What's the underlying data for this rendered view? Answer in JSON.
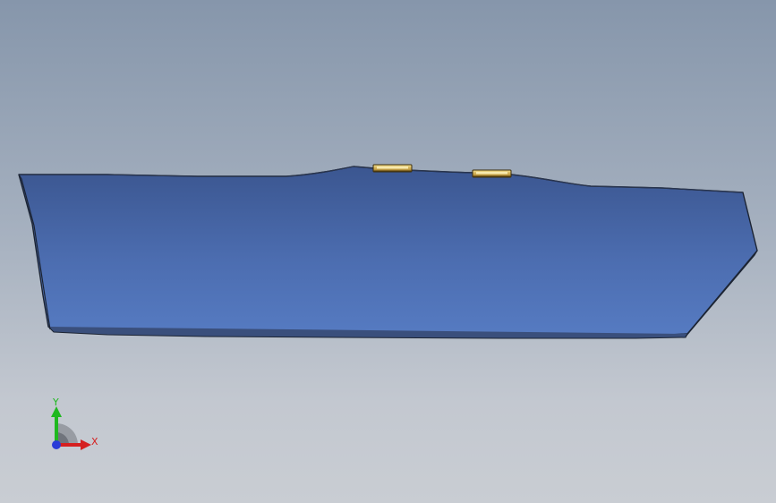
{
  "viewport": {
    "background_top": "#8696ab",
    "background_bottom": "#c9cdd3"
  },
  "model": {
    "body_color_top": "#3f5b92",
    "body_color_bottom": "#5478bf",
    "edge_color": "#1c2433",
    "tab_color": "#c9a54a",
    "tab_highlight": "#f3df8e"
  },
  "triad": {
    "y_label": "Y",
    "x_label": "X",
    "y_color": "#1fb81f",
    "x_color": "#d52020",
    "z_color": "#2a3bd8"
  }
}
